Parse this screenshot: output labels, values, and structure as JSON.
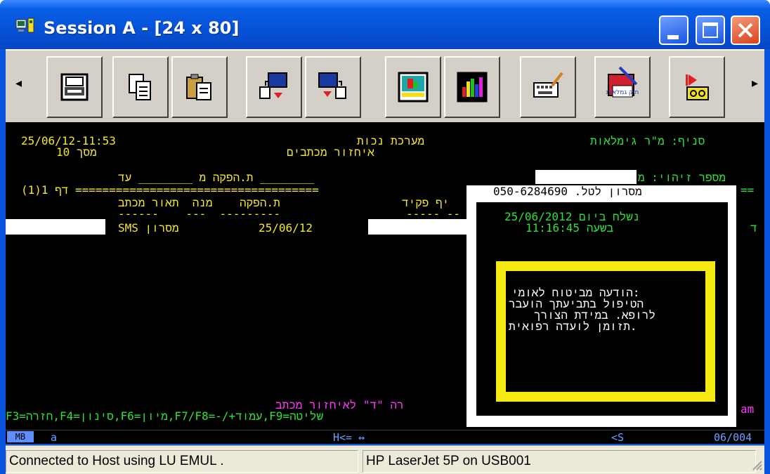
{
  "window": {
    "title": "Session A - [24 x 80]",
    "icons": [
      "app-icon",
      "minimize-icon",
      "maximize-icon",
      "close-icon"
    ]
  },
  "toolbar": {
    "buttons": [
      {
        "icon": "print-icon"
      },
      {
        "icon": "copy-icon"
      },
      {
        "icon": "paste-icon"
      },
      {
        "icon": "send-file-icon"
      },
      {
        "icon": "receive-file-icon"
      },
      {
        "icon": "display-setup-icon"
      },
      {
        "icon": "color-map-icon"
      },
      {
        "icon": "keyboard-map-icon"
      },
      {
        "icon": "gimlaot-app-icon",
        "label": "תיק גמלאות"
      },
      {
        "icon": "macro-play-icon"
      }
    ]
  },
  "terminal": {
    "datetime": "25/06/12-11:53",
    "screen_no": "10 מסך",
    "system_name": "מערכת נכות",
    "subsystem_name": "איחזור מכתבים",
    "branch": "סניף: מ\"ר גימלאות",
    "id_label": "מספר זיהוי: מ",
    "date_range": "ת.הפקה מ ________ עד ________",
    "page_marker": "(1)1 דף ====================================",
    "right_rule": "==",
    "col_headers": "ת.הפקה    מנה  תאור מכתב",
    "col_clerk": "יף פקיד",
    "col_underline": "------    ---  ---------",
    "col_underline2": "----- --",
    "row_type": "SMS מסרון",
    "row_date": "25/06/12",
    "row_right_char": "ד",
    "bottom_prompt": "רה \"ד\" לאיחזור מכתב",
    "func_keys": "F3=חזרה,F4=סינון,F6=מיון,F7/F8=-/+עמוד,F9=שליטה",
    "am": "am"
  },
  "popup": {
    "header": "מסרון לטל. 050-6284690",
    "sent_date": "נשלח ביום 25/06/2012",
    "sent_time": "בשעה 11:16:45",
    "message_lines": [
      "הודעה מביטוח לאומי:",
      "הטיפול בתביעתך הועבר",
      "לרופא. במידת הצורך",
      "תזומן לועדה רפואית."
    ]
  },
  "status_line": {
    "mode": "MB",
    "a": "a",
    "arrows": "H<= ↔",
    "s": "<S",
    "position": "06/004"
  },
  "statusbar": {
    "connection": "Connected to Host using LU EMUL    .",
    "printer": "HP LaserJet 5P on USB001"
  },
  "colors": {
    "title_blue": "#0a55e0",
    "terminal_bg": "#000000",
    "yellow": "#f5e631",
    "green": "#2fe03a",
    "magenta": "#ff38ff",
    "popup_border": "#f5ea10"
  }
}
